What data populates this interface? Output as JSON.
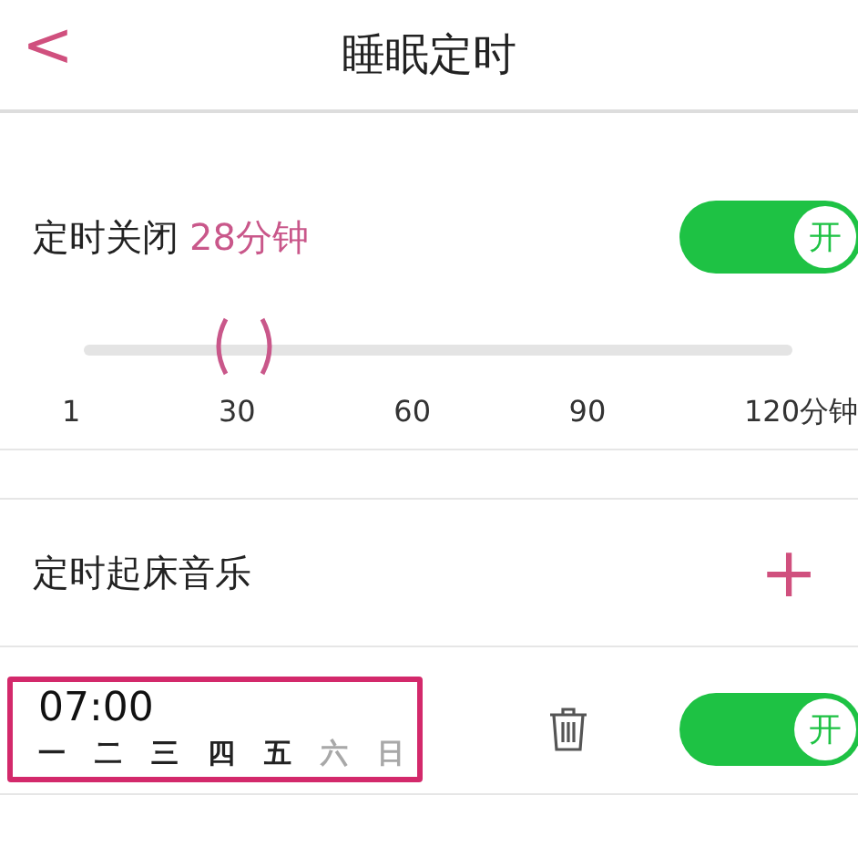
{
  "header": {
    "title": "睡眠定时",
    "back": "<"
  },
  "sleep_timer": {
    "label": "定时关闭",
    "value": "28分钟",
    "toggle": {
      "on": true,
      "label": "开"
    },
    "slider": {
      "level": 0.227
    },
    "ticks": [
      "1",
      "30",
      "60",
      "90",
      "120分钟"
    ]
  },
  "wake_music": {
    "label": "定时起床音乐",
    "add": "+"
  },
  "alarms": [
    {
      "time": "07:00",
      "highlighted": true,
      "toggle": {
        "on": true,
        "label": "开"
      },
      "days": [
        {
          "label": "一",
          "active": true
        },
        {
          "label": "二",
          "active": true
        },
        {
          "label": "三",
          "active": true
        },
        {
          "label": "四",
          "active": true
        },
        {
          "label": "五",
          "active": true
        },
        {
          "label": "六",
          "active": false
        },
        {
          "label": "日",
          "active": false
        }
      ]
    }
  ]
}
